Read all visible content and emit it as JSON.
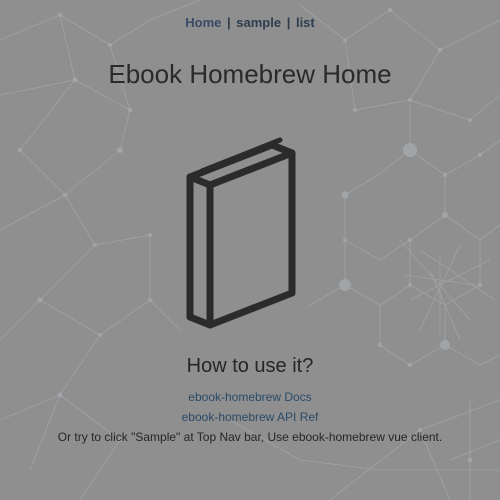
{
  "nav": {
    "home_label": "Home",
    "separator": "|",
    "sample_label": "sample",
    "list_label": "list"
  },
  "page_title": "Ebook Homebrew Home",
  "logo_icon": "book-icon",
  "how_to": {
    "heading": "How to use it?",
    "docs_link": "ebook-homebrew Docs",
    "api_link": "ebook-homebrew API Ref",
    "hint_text": "Or try to click \"Sample\" at Top Nav bar, Use ebook-homebrew vue client."
  },
  "colors": {
    "background": "#8f8f90",
    "text": "#2f2f2f",
    "link": "#2a4a66",
    "network_lines": "#a4a8ab"
  }
}
